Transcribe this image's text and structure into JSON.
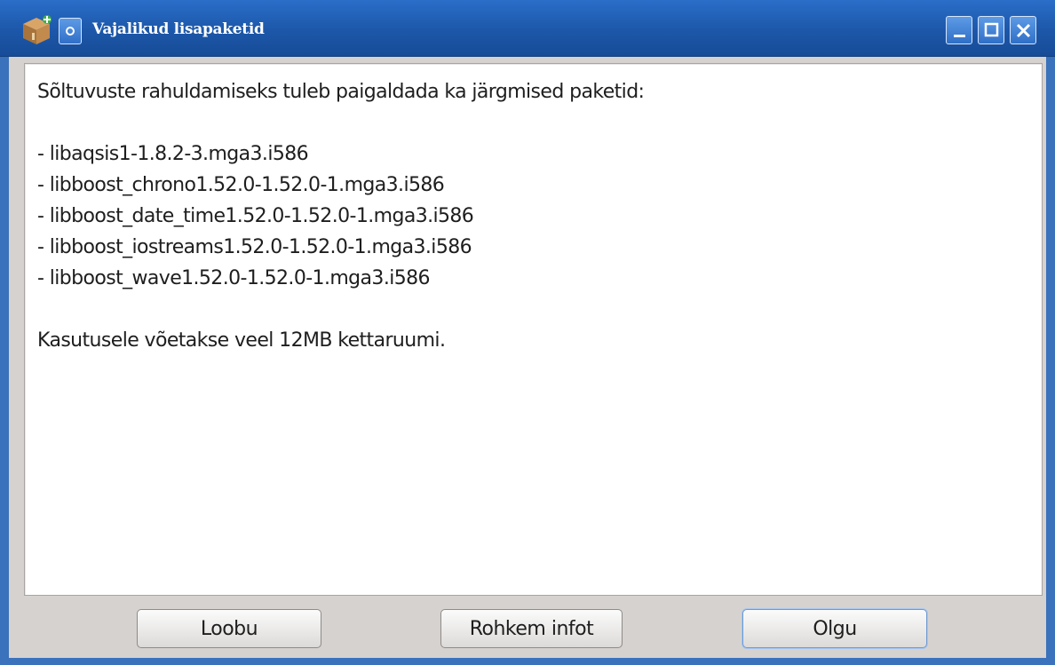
{
  "window": {
    "title": "Vajalikud lisapaketid",
    "icon": "package-icon"
  },
  "message": {
    "intro": "Sõltuvuste rahuldamiseks tuleb paigaldada ka järgmised paketid:",
    "packages": [
      "- libaqsis1-1.8.2-3.mga3.i586",
      "- libboost_chrono1.52.0-1.52.0-1.mga3.i586",
      "- libboost_date_time1.52.0-1.52.0-1.mga3.i586",
      "- libboost_iostreams1.52.0-1.52.0-1.mga3.i586",
      "- libboost_wave1.52.0-1.52.0-1.mga3.i586"
    ],
    "summary": "Kasutusele võetakse veel 12MB kettaruumi."
  },
  "buttons": {
    "cancel": "Loobu",
    "more_info": "Rohkem infot",
    "ok": "Olgu"
  },
  "colors": {
    "titlebar": "#1c57a9",
    "frame": "#3a72bb",
    "dialog_bg": "#d6d2d0",
    "default_button_focus": "#6d9ad3"
  }
}
